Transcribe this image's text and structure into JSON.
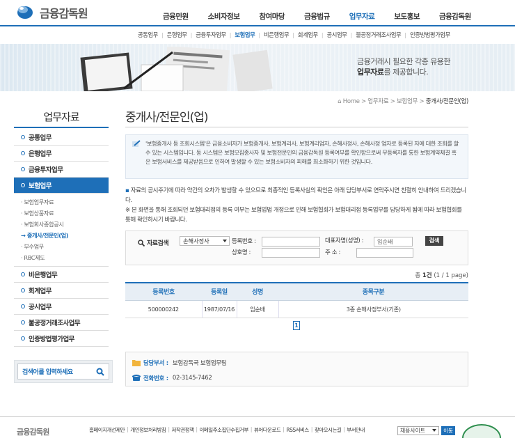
{
  "header": {
    "logo_text": "금융감독원",
    "gnb": [
      {
        "label": "금융민원",
        "active": false
      },
      {
        "label": "소비자정보",
        "active": false
      },
      {
        "label": "참여마당",
        "active": false
      },
      {
        "label": "금융법규",
        "active": false
      },
      {
        "label": "업무자료",
        "active": true
      },
      {
        "label": "보도홍보",
        "active": false
      },
      {
        "label": "금융감독원",
        "active": false
      }
    ],
    "lnb": [
      "공통업무",
      "은행업무",
      "금융투자업무",
      "보험업무",
      "비은행업무",
      "회계업무",
      "공시업무",
      "불공정거래조사업무",
      "인증방법평가업무"
    ],
    "lnb_active": "보험업무"
  },
  "banner": {
    "line1": "금융거래시 필요한 각종 유용한",
    "line2_bold": "업무자료",
    "line2_rest": "를 제공합니다."
  },
  "sidebar": {
    "title": "업무자료",
    "items_top": [
      "공통업무",
      "은행업무",
      "금융투자업무"
    ],
    "active_item": "보험업무",
    "sub_items": [
      "보험업무자료",
      "보험상품자료",
      "보험회사종합공시",
      "중개사/전문인(업)",
      "부수업무",
      "RBC제도"
    ],
    "sub_active": "중개사/전문인(업)",
    "items_bottom": [
      "비은행업무",
      "회계업무",
      "공시업무",
      "불공정거래조사업무",
      "인증방법평가업무"
    ],
    "search_placeholder": "검색어를 입력하세요"
  },
  "breadcrumb": {
    "home": "Home",
    "path": [
      "업무자료",
      "보험업무"
    ],
    "current": "중개사/전문인(업)"
  },
  "page_title": "중개사/전문인(업)",
  "intro_text": "'보험중개사 등 조회시스템'은 금융소비자가 보험중개사, 보험계리사, 보험계리업자, 손해사정사, 손해사정 업자로 등록된 자에 대한 조회를 할 수 있는 시스템입니다. 동 시스템은 보험모집종사자 및 보험전문인의 금융감독원 등록여부를 확인함으로써 무등록자를 통한 보험계약체결 혹은 보험서비스를 제공받음으로 인하여 발생할 수 있는 보험소비자의 피해를 최소화하기 위한 것입니다.",
  "notice": {
    "line1_prefix": "▪",
    "line1": "자료의 공시주기에 따라 약간의 오차가 발생할 수 있으므로 최종적인 등록사실의 확인은 아래 담당부서로 연락주시면 친절히 안내하여 드리겠습니다.",
    "line2": "※ 본 화면을 통해 조회되던 보험대리점의 등록 여부는 보험업법 개정으로 인해 보험협회가 보험대리점 등록업무를 담당하게 됨에 따라 보험협회를 통해 확인하시기 바랍니다."
  },
  "search_form": {
    "label": "자료검색",
    "select_value": "손해사정사",
    "reg_no_label": "등록번호 :",
    "reg_no_value": "",
    "ceo_label": "대표자명(성명) :",
    "ceo_value": "임순배",
    "trade_label": "상호명 :",
    "trade_value": "",
    "addr_label": "주 소 :",
    "addr_value": "",
    "button": "검색"
  },
  "result_count": {
    "prefix": "총",
    "count": "1건",
    "paging": "(1 / 1 page)"
  },
  "table": {
    "headers": [
      "등록번호",
      "등록일",
      "성명",
      "종목구분"
    ],
    "rows": [
      [
        "500000242",
        "1987/07/16",
        "임순배",
        "3종 손해사정부서(기존)"
      ]
    ]
  },
  "pagination": {
    "current": "1"
  },
  "contact": {
    "dept_label": "담당부서 :",
    "dept_value": "보험감독국 보험업무팀",
    "phone_label": "전화번호 :",
    "phone_value": "02-3145-7462"
  },
  "footer": {
    "logo_text": "금융감독원",
    "links": [
      "홈페이지개선제안",
      "개인정보처리방침",
      "저작권정책",
      "이메일주소집단수집거부",
      "뷰어다운로드",
      "RSS서비스",
      "찾아오시는길",
      "부서안내"
    ],
    "select_value": "채용사이트",
    "go_button": "이동"
  },
  "colors": {
    "accent": "#1e6fb8",
    "panel": "#f3f7fb",
    "table_header": "#e7eef5"
  },
  "icons": [
    "logo-globe-icon",
    "pencil-icon",
    "search-icon",
    "magnifier-icon",
    "folder-icon",
    "phone-icon",
    "home-icon",
    "seal-icon"
  ]
}
